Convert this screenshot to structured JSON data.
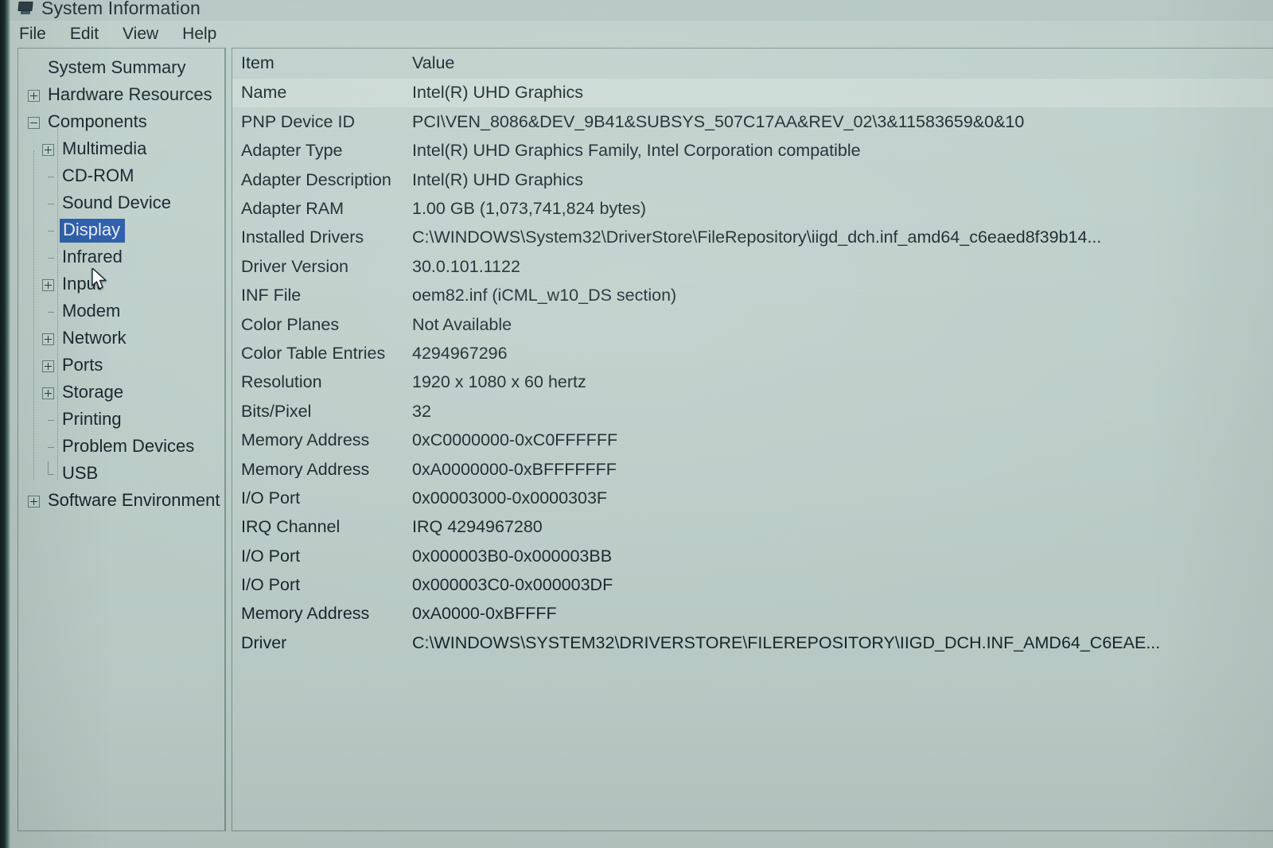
{
  "window": {
    "title": "System Information",
    "icon": "computer-icon"
  },
  "menu": {
    "items": [
      {
        "label": "File"
      },
      {
        "label": "Edit"
      },
      {
        "label": "View"
      },
      {
        "label": "Help"
      }
    ]
  },
  "tree": {
    "selected": "Display",
    "selection_color": "#2a5ca8",
    "items": [
      {
        "label": "System Summary",
        "depth": 0,
        "expander": "none",
        "connector": "none"
      },
      {
        "label": "Hardware Resources",
        "depth": 0,
        "expander": "plus",
        "connector": "none"
      },
      {
        "label": "Components",
        "depth": 0,
        "expander": "minus",
        "connector": "none"
      },
      {
        "label": "Multimedia",
        "depth": 1,
        "expander": "plus",
        "connector": "none"
      },
      {
        "label": "CD-ROM",
        "depth": 1,
        "expander": "leaf",
        "connector": "tee"
      },
      {
        "label": "Sound Device",
        "depth": 1,
        "expander": "leaf",
        "connector": "tee"
      },
      {
        "label": "Display",
        "depth": 1,
        "expander": "leaf",
        "connector": "tee",
        "selected": true
      },
      {
        "label": "Infrared",
        "depth": 1,
        "expander": "leaf",
        "connector": "tee"
      },
      {
        "label": "Input",
        "depth": 1,
        "expander": "plus",
        "connector": "none"
      },
      {
        "label": "Modem",
        "depth": 1,
        "expander": "leaf",
        "connector": "tee"
      },
      {
        "label": "Network",
        "depth": 1,
        "expander": "plus",
        "connector": "none"
      },
      {
        "label": "Ports",
        "depth": 1,
        "expander": "plus",
        "connector": "none"
      },
      {
        "label": "Storage",
        "depth": 1,
        "expander": "plus",
        "connector": "none"
      },
      {
        "label": "Printing",
        "depth": 1,
        "expander": "leaf",
        "connector": "tee"
      },
      {
        "label": "Problem Devices",
        "depth": 1,
        "expander": "leaf",
        "connector": "tee"
      },
      {
        "label": "USB",
        "depth": 1,
        "expander": "leaf",
        "connector": "last"
      },
      {
        "label": "Software Environment",
        "depth": 0,
        "expander": "plus",
        "connector": "none"
      }
    ]
  },
  "detail": {
    "columns": {
      "item": "Item",
      "value": "Value"
    },
    "rows": [
      {
        "item": "Name",
        "value": "Intel(R) UHD Graphics",
        "highlight": true
      },
      {
        "item": "PNP Device ID",
        "value": "PCI\\VEN_8086&DEV_9B41&SUBSYS_507C17AA&REV_02\\3&11583659&0&10"
      },
      {
        "item": "Adapter Type",
        "value": "Intel(R) UHD Graphics Family, Intel Corporation compatible"
      },
      {
        "item": "Adapter Description",
        "value": "Intel(R) UHD Graphics"
      },
      {
        "item": "Adapter RAM",
        "value": "1.00 GB (1,073,741,824 bytes)"
      },
      {
        "item": "Installed Drivers",
        "value": "C:\\WINDOWS\\System32\\DriverStore\\FileRepository\\iigd_dch.inf_amd64_c6eaed8f39b14..."
      },
      {
        "item": "Driver Version",
        "value": "30.0.101.1122"
      },
      {
        "item": "INF File",
        "value": "oem82.inf (iCML_w10_DS section)"
      },
      {
        "item": "Color Planes",
        "value": "Not Available"
      },
      {
        "item": "Color Table Entries",
        "value": "4294967296"
      },
      {
        "item": "Resolution",
        "value": "1920 x 1080 x 60 hertz"
      },
      {
        "item": "Bits/Pixel",
        "value": "32"
      },
      {
        "item": "Memory Address",
        "value": "0xC0000000-0xC0FFFFFF"
      },
      {
        "item": "Memory Address",
        "value": "0xA0000000-0xBFFFFFFF"
      },
      {
        "item": "I/O Port",
        "value": "0x00003000-0x0000303F"
      },
      {
        "item": "IRQ Channel",
        "value": "IRQ 4294967280"
      },
      {
        "item": "I/O Port",
        "value": "0x000003B0-0x000003BB"
      },
      {
        "item": "I/O Port",
        "value": "0x000003C0-0x000003DF"
      },
      {
        "item": "Memory Address",
        "value": "0xA0000-0xBFFFF"
      },
      {
        "item": "Driver",
        "value": "C:\\WINDOWS\\SYSTEM32\\DRIVERSTORE\\FILEREPOSITORY\\IIGD_DCH.INF_AMD64_C6EAE..."
      }
    ]
  },
  "theme": {
    "background": "#bdcec9",
    "text": "#17262c",
    "border": "#7e9690",
    "row_highlight": "#cad9d4"
  }
}
